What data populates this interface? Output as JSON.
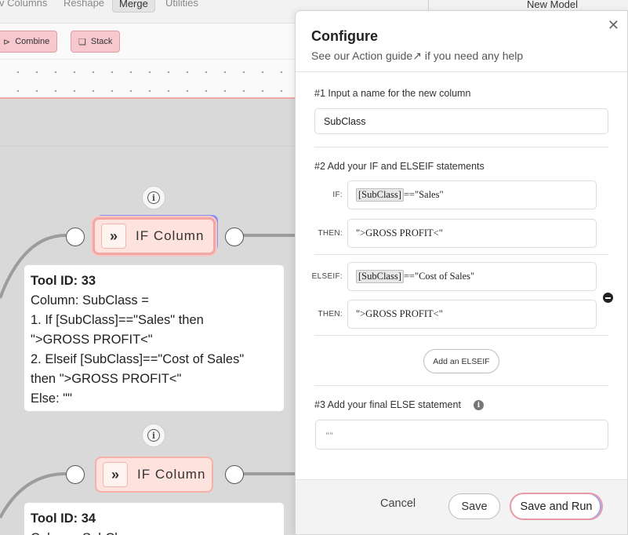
{
  "topbar": {
    "tabs": [
      {
        "label": "v Columns"
      },
      {
        "label": "Reshape"
      },
      {
        "label": "Merge"
      },
      {
        "label": "Utilities"
      }
    ],
    "right_title": "New Model"
  },
  "toolbar": {
    "combine_label": "Combine",
    "stack_label": "Stack"
  },
  "flow": {
    "nodes": [
      {
        "label": "IF Column",
        "tool_id": "Tool ID: 33",
        "lines": [
          "Column: SubClass =",
          "1. If [SubClass]==\"Sales\" then",
          "\">GROSS PROFIT<\"",
          "2. Elseif [SubClass]==\"Cost of Sales\"",
          "then \">GROSS PROFIT<\"",
          "Else: \"\""
        ]
      },
      {
        "label": "IF Column",
        "tool_id": "Tool ID: 34",
        "lines": [
          "Column: SubClass ="
        ]
      }
    ],
    "behind_text": "\">GROSS PROFIT<\""
  },
  "configure": {
    "title": "Configure",
    "subtitle_prefix": "See our ",
    "guide_link": "Action guide",
    "subtitle_suffix": " if you need any help",
    "step1_label": "#1 Input a name for the new column",
    "column_name": "SubClass",
    "step2_label": "#2 Add your IF and ELSEIF statements",
    "if_label": "IF:",
    "then_label": "THEN:",
    "elseif_label": "ELSEIF:",
    "if_token": "[SubClass]",
    "if_rest": "==\"Sales\"",
    "if_then": "\">GROSS PROFIT<\"",
    "elseif_token": "[SubClass]",
    "elseif_rest": "==\"Cost of Sales\"",
    "elseif_then": "\">GROSS PROFIT<\"",
    "add_elseif_label": "Add an ELSEIF",
    "step3_label": "#3 Add your final ELSE statement",
    "else_value": "\"\"",
    "cancel_label": "Cancel",
    "save_label": "Save",
    "save_run_label": "Save and Run"
  }
}
